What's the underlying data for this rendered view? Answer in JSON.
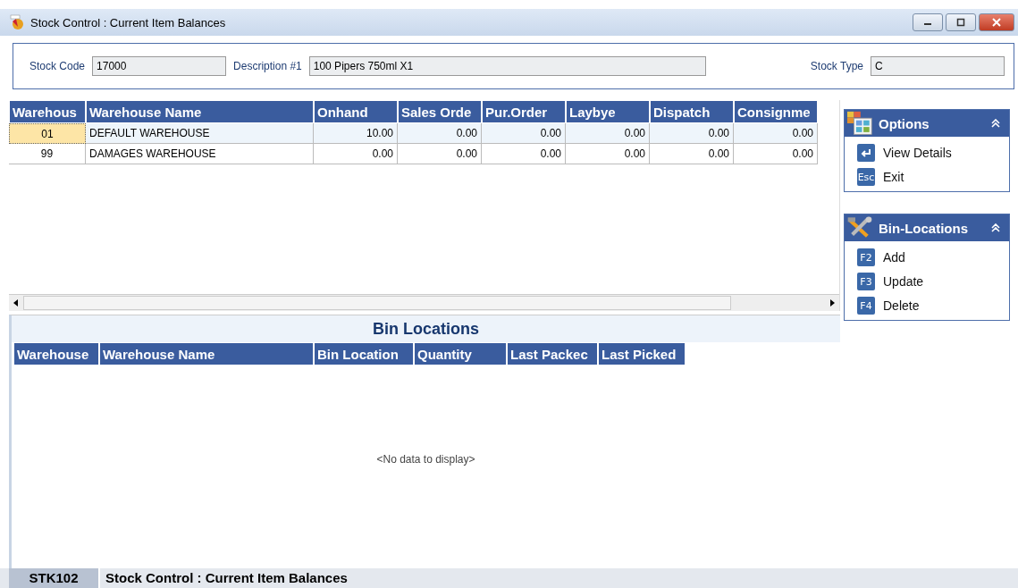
{
  "window": {
    "title": "Stock Control : Current Item Balances"
  },
  "header": {
    "fields": [
      {
        "label": "Stock Code",
        "value": "17000"
      },
      {
        "label": "Description #1",
        "value": "100 Pipers 750ml X1"
      },
      {
        "label": "Stock Type",
        "value": "C"
      }
    ]
  },
  "balances": {
    "columns": [
      "Warehous",
      "Warehouse Name",
      "Onhand",
      "Sales Orde",
      "Pur.Order",
      "Laybye",
      "Dispatch",
      "Consignme"
    ],
    "rows": [
      {
        "selected": true,
        "cells": [
          "01",
          "DEFAULT WAREHOUSE",
          "10.00",
          "0.00",
          "0.00",
          "0.00",
          "0.00",
          "0.00"
        ]
      },
      {
        "selected": false,
        "cells": [
          "99",
          "DAMAGES WAREHOUSE",
          "0.00",
          "0.00",
          "0.00",
          "0.00",
          "0.00",
          "0.00"
        ]
      }
    ]
  },
  "bin_locations": {
    "title": "Bin Locations",
    "columns": [
      "Warehouse",
      "Warehouse Name",
      "Bin Location",
      "Quantity",
      "Last Packec",
      "Last Picked"
    ],
    "empty_text": "<No data to display>"
  },
  "panels": [
    {
      "title": "Options",
      "kind": "options",
      "items": [
        {
          "kind": "enter",
          "label": "View Details"
        },
        {
          "kind": "key",
          "key": "Esc",
          "label": "Exit"
        }
      ]
    },
    {
      "title": "Bin-Locations",
      "kind": "tools",
      "items": [
        {
          "kind": "key",
          "key": "F2",
          "label": "Add"
        },
        {
          "kind": "key",
          "key": "F3",
          "label": "Update"
        },
        {
          "kind": "key",
          "key": "F4",
          "label": "Delete"
        }
      ]
    }
  ],
  "status_bar": {
    "code": "STK102",
    "text": "Stock Control : Current Item Balances"
  }
}
